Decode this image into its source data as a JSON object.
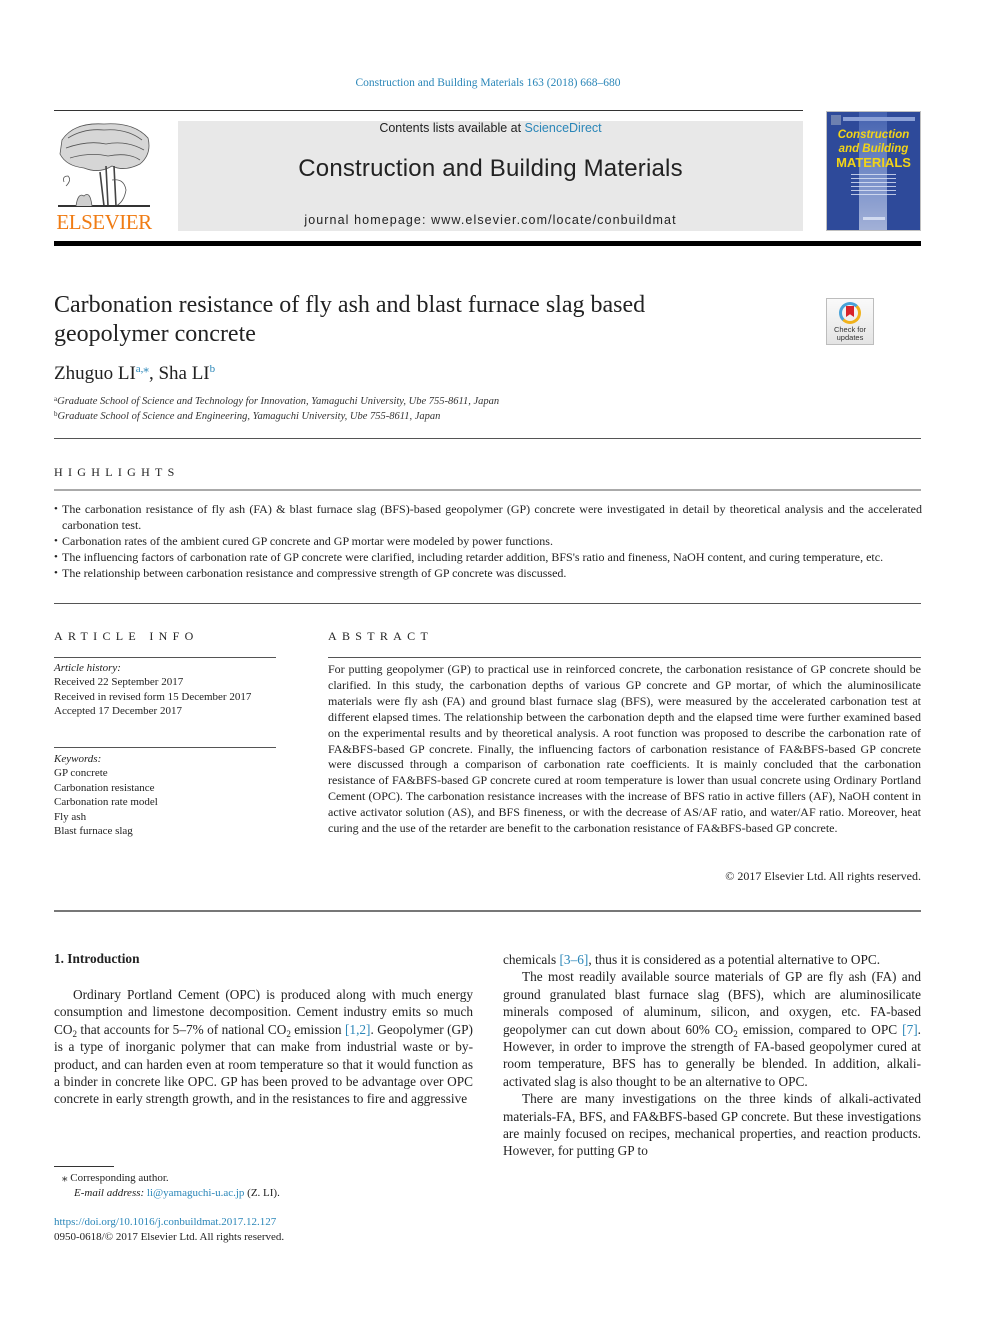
{
  "header": {
    "citation": "Construction and Building Materials 163 (2018) 668–680",
    "contents_prefix": "Contents lists available at ",
    "contents_link": "ScienceDirect",
    "journal_title": "Construction and Building Materials",
    "homepage_prefix": "journal homepage: ",
    "homepage_url": "www.elsevier.com/locate/conbuildmat",
    "publisher_logo_text": "ELSEVIER",
    "cover": {
      "line1": "Construction",
      "line2": "and Building",
      "line3": "MATERIALS"
    },
    "colors": {
      "link": "#2a86b8",
      "elsevier_orange": "#f07c14",
      "cover_blue": "#2e4a9a",
      "cover_yellow": "#f3d417"
    }
  },
  "article": {
    "title_line1": "Carbonation resistance of fly ash and blast furnace slag based",
    "title_line2": "geopolymer concrete",
    "crossmark": {
      "line1": "Check for",
      "line2": "updates"
    },
    "authors": [
      {
        "name": "Zhuguo LI",
        "sup": "a,⁎"
      },
      {
        "name": "Sha LI",
        "sup": "b"
      }
    ],
    "author_separator": ", ",
    "affiliations": [
      {
        "key": "a",
        "text": "Graduate School of Science and Technology for Innovation, Yamaguchi University, Ube 755-8611, Japan"
      },
      {
        "key": "b",
        "text": "Graduate School of Science and Engineering, Yamaguchi University, Ube 755-8611, Japan"
      }
    ]
  },
  "highlights": {
    "label": "HIGHLIGHTS",
    "items": [
      "The carbonation resistance of fly ash (FA) & blast furnace slag (BFS)-based geopolymer (GP) concrete were investigated in detail by theoretical analysis and the accelerated carbonation test.",
      "Carbonation rates of the ambient cured GP concrete and GP mortar were modeled by power functions.",
      "The influencing factors of carbonation rate of GP concrete were clarified, including retarder addition, BFS's ratio and fineness, NaOH content, and curing temperature, etc.",
      "The relationship between carbonation resistance and compressive strength of GP concrete was discussed."
    ]
  },
  "article_info": {
    "label": "ARTICLE INFO",
    "history_label": "Article history:",
    "history": [
      "Received 22 September 2017",
      "Received in revised form 15 December 2017",
      "Accepted 17 December 2017"
    ],
    "keywords_label": "Keywords:",
    "keywords": [
      "GP concrete",
      "Carbonation resistance",
      "Carbonation rate model",
      "Fly ash",
      "Blast furnace slag"
    ]
  },
  "abstract": {
    "label": "ABSTRACT",
    "text": "For putting geopolymer (GP) to practical use in reinforced concrete, the carbonation resistance of GP concrete should be clarified. In this study, the carbonation depths of various GP concrete and GP mortar, of which the aluminosilicate materials were fly ash (FA) and ground blast furnace slag (BFS), were measured by the accelerated carbonation test at different elapsed times. The relationship between the carbonation depth and the elapsed time were further examined based on the experimental results and by theoretical analysis. A root function was proposed to describe the carbonation rate of FA&BFS-based GP concrete. Finally, the influencing factors of carbonation resistance of FA&BFS-based GP concrete were discussed through a comparison of carbonation rate coefficients. It is mainly concluded that the carbonation resistance of FA&BFS-based GP concrete cured at room temperature is lower than usual concrete using Ordinary Portland Cement (OPC). The carbonation resistance increases with the increase of BFS ratio in active fillers (AF), NaOH content in active activator solution (AS), and BFS fineness, or with the decrease of AS/AF ratio, and water/AF ratio. Moreover, heat curing and the use of the retarder are benefit to the carbonation resistance of FA&BFS-based GP concrete.",
    "copyright": "© 2017 Elsevier Ltd. All rights reserved."
  },
  "body": {
    "section_heading": "1. Introduction",
    "left_p1": {
      "t1": "Ordinary Portland Cement (OPC) is produced along with much energy consumption and limestone decomposition. Cement industry emits so much CO",
      "sub1": "2",
      "t2": " that accounts for 5–7% of national CO",
      "sub2": "2",
      "t3": " emission ",
      "ref1": "[1,2]",
      "t4": ". Geopolymer (GP) is a type of inorganic polymer that can make from industrial waste or by-product, and can harden even at room temperature so that it would function as a binder in concrete like OPC. GP has been proved to be advantage over OPC concrete in early strength growth, and in the resistances to fire and aggressive"
    },
    "right_p1": {
      "t1": "chemicals ",
      "ref1": "[3–6]",
      "t2": ", thus it is considered as a potential alternative to OPC."
    },
    "right_p2": {
      "t1": "The most readily available source materials of GP are fly ash (FA) and ground granulated blast furnace slag (BFS), which are aluminosilicate minerals composed of aluminum, silicon, and oxygen, etc. FA-based geopolymer can cut down about 60% CO",
      "sub1": "2",
      "t2": " emission, compared to OPC ",
      "ref1": "[7]",
      "t3": ". However, in order to improve the strength of FA-based geopolymer cured at room temperature, BFS has to generally be blended. In addition, alkali-activated slag is also thought to be an alternative to OPC."
    },
    "right_p3": "There are many investigations on the three kinds of alkali-activated materials-FA, BFS, and FA&BFS-based GP concrete. But these investigations are mainly focused on recipes, mechanical properties, and reaction products. However, for putting GP to"
  },
  "footnotes": {
    "corresponding_mark": "⁎",
    "corresponding_text": "Corresponding author.",
    "email_label": "E-mail address:",
    "email": "li@yamaguchi-u.ac.jp",
    "email_suffix": " (Z. LI).",
    "doi": "https://doi.org/10.1016/j.conbuildmat.2017.12.127",
    "issn": "0950-0618/© 2017 Elsevier Ltd. All rights reserved."
  }
}
